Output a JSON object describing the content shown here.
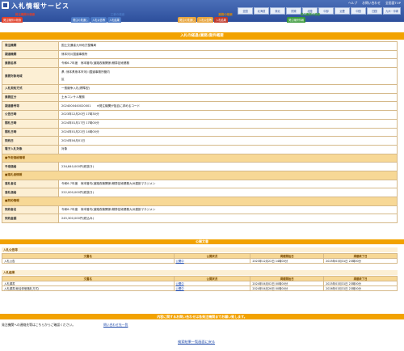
{
  "header": {
    "site_title": "入札情報サービス",
    "util_links": [
      "ヘルプ",
      "お問い合わせ",
      "全画面TOP"
    ],
    "regions": [
      "全国",
      "北海道",
      "東北",
      "関東",
      "北陸",
      "中部",
      "近畿",
      "中国",
      "四国",
      "九州・沖縄"
    ]
  },
  "categories": [
    {
      "head": "発注機関の検索",
      "color": "#e0402a",
      "tabs": [
        {
          "label": "発注機関の検索",
          "color": "#e0402a"
        }
      ]
    },
    {
      "head": "工事の検索",
      "color": "#4a78c4",
      "tabs": [
        {
          "label": "発注の見通し",
          "color": "#4a78c4"
        },
        {
          "label": "入札公告等",
          "color": "#4a78c4"
        },
        {
          "label": "入札結果",
          "color": "#4a78c4"
        }
      ]
    },
    {
      "head": "業務の検索",
      "color": "#e08a00",
      "tabs": [
        {
          "label": "発注の見通し",
          "color": "#e8a640"
        },
        {
          "label": "入札公告等",
          "color": "#e8a640"
        },
        {
          "label": "入札結果",
          "color": "#c0392b"
        }
      ]
    },
    {
      "head": "発注機関の検索",
      "color": "#3a9a3a",
      "tabs": [
        {
          "label": "発注機関情報",
          "color": "#3a9a3a"
        }
      ]
    }
  ],
  "page_title": "入札の経過(業務)案件概要",
  "detail_rows": [
    {
      "type": "kv",
      "key": "発注機関",
      "value": "国土交通省九州地方整備局"
    },
    {
      "type": "kv",
      "key": "調達機関",
      "value": "熊本河川国道事務所"
    },
    {
      "type": "kv",
      "key": "業務名称",
      "value": "令和6-7年度　熊本管内(道路改築関係)積算技術業務"
    },
    {
      "type": "kv2",
      "key": "業務対象地域",
      "value": "県: 熊本県熊本市河川国道事務所管内",
      "value2": "区"
    },
    {
      "type": "kv",
      "key": "入札契約方式",
      "value": "一般競争入札(標準型)"
    },
    {
      "type": "kv",
      "key": "業務区分",
      "value": "土木コンサル業務"
    },
    {
      "type": "kv",
      "key": "調達番号等",
      "value": "2024000440020001　　※発注機関が独自に求めるコード"
    },
    {
      "type": "kv",
      "key": "公告日時",
      "value": "2023年12月20日 17時30分"
    },
    {
      "type": "kv",
      "key": "開札日時",
      "value": "2024年01月17日 17時00分"
    },
    {
      "type": "kv",
      "key": "開札日時",
      "value": "2024年01月22日 14時00分"
    },
    {
      "type": "kv",
      "key": "契約日",
      "value": "2024年04月01日"
    },
    {
      "type": "kv",
      "key": "電子入札対象",
      "value": "対象"
    },
    {
      "type": "sec",
      "key": "■予定価格情報"
    },
    {
      "type": "kv",
      "key": "予定価格",
      "value": "234,840,000円(税抜き)"
    },
    {
      "type": "sec",
      "key": "■落札者情報"
    },
    {
      "type": "kv",
      "key": "落札者名",
      "value": "令和6-7年度　熊本管内(道路改築関係)積算技術業務九州建設マネジメン"
    },
    {
      "type": "kv",
      "key": "落札価格",
      "value": "222,000,000円(税抜き)"
    },
    {
      "type": "sec",
      "key": "■契約情報"
    },
    {
      "type": "kv",
      "key": "契約者名",
      "value": "令和6-7年度　熊本管内(道路改築関係)積算技術業務九州建設マネジメン"
    },
    {
      "type": "kv",
      "key": "契約金額",
      "value": "245,300,000円(税込み)"
    }
  ],
  "public_docs": {
    "title": "公開文書",
    "notice_label": "入札公告等",
    "columns": [
      "文書名",
      "公開状況",
      "掲載開始日",
      "掲載終了日"
    ],
    "notice_rows": [
      {
        "name": "入札公告",
        "status": "公開中",
        "start": "2023年12月22日 14時00分",
        "end": "2025年03月31日 23時00分"
      }
    ],
    "result_label": "入札結果",
    "result_rows": [
      {
        "name": "入札調書",
        "status": "公開中",
        "start": "2024年04月02日 00時00分",
        "end": "2025年03月31日 23時00分"
      },
      {
        "name": "入札調書(総合評価落札方式)",
        "status": "公開中",
        "start": "2024年04月26日 00時00分",
        "end": "2026年03月31日 23時00分"
      }
    ]
  },
  "inquiry": {
    "bar": "内容に関するお問い合わせは各発注機関までお願い致します。",
    "text": "発注機関への連絡先等はこちらからご確認ください。",
    "link": "問い合わせ先一覧"
  },
  "footer": {
    "back_link": "検索結果一覧画面に戻る"
  }
}
